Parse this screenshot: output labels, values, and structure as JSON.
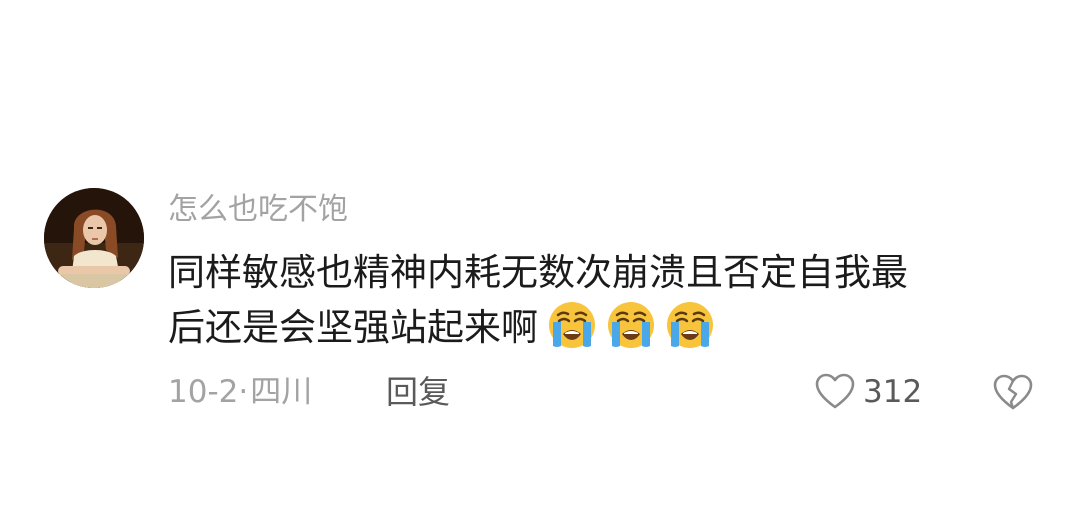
{
  "comment": {
    "username": "怎么也吃不饱",
    "text_line1": "同样敏感也精神内耗无数次崩溃且否定自我最",
    "text_line2": "后还是会坚强站起来啊",
    "emojis": [
      "loudly-crying-face-emoji",
      "loudly-crying-face-emoji",
      "loudly-crying-face-emoji"
    ],
    "date": "10-2",
    "separator": "·",
    "location": "四川",
    "reply_label": "回复",
    "like_count": "312"
  },
  "colors": {
    "username": "#a3a3a3",
    "text": "#1b1b1b",
    "meta": "#a3a3a3",
    "action": "#5a5a5a",
    "emoji_face": "#f7c43c",
    "emoji_tears": "#4aa8e8"
  }
}
